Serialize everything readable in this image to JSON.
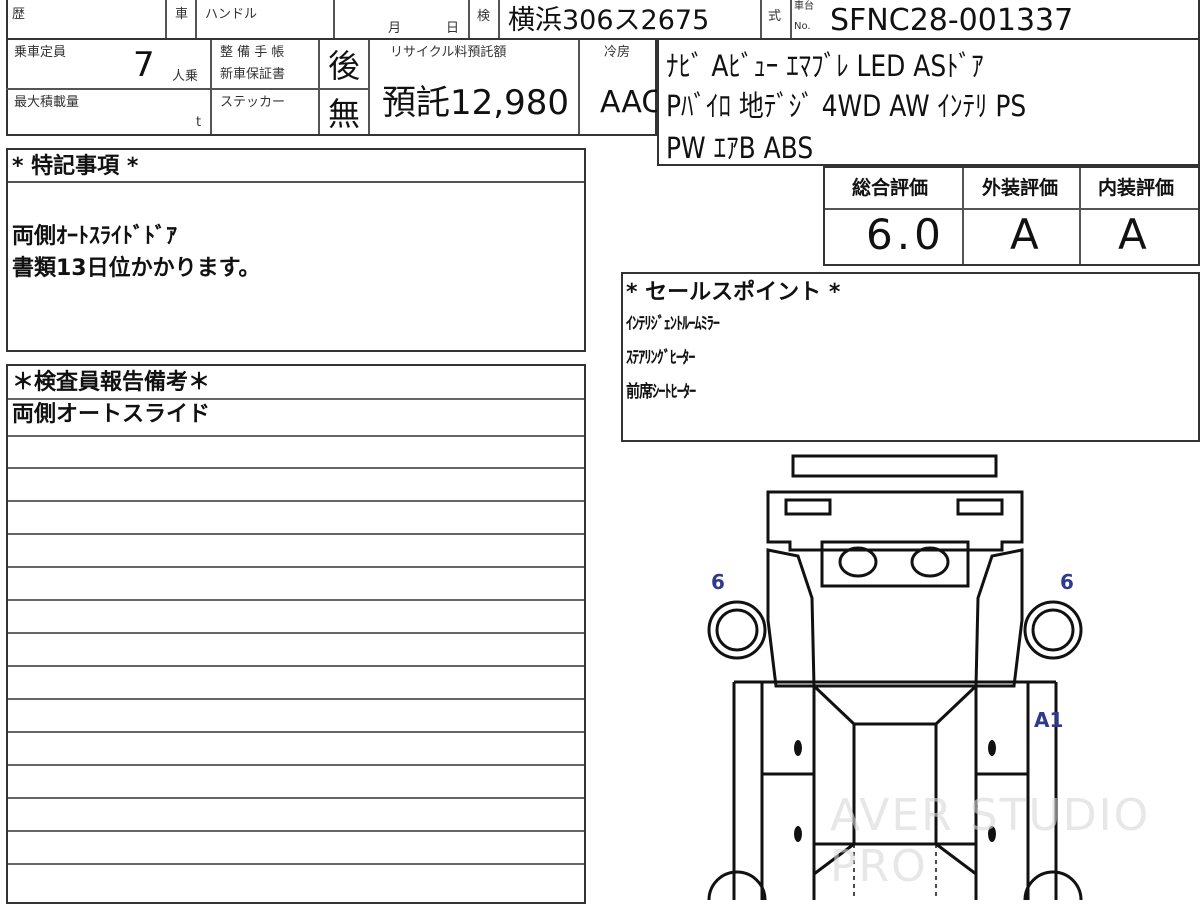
{
  "header": {
    "history_label": "歴",
    "steering_label_1": "車",
    "steering_label_2": "ハンドル",
    "month_label": "月",
    "day_label": "日",
    "inspection_label": "検",
    "plate_number": "横浜306ス2675",
    "model_label": "式",
    "chassis_label_1": "車台",
    "chassis_label_2": "No.",
    "chassis_number": "SFNC28-001337"
  },
  "row2": {
    "capacity_label": "乗車定員",
    "capacity_value": "7",
    "capacity_unit": "人乗",
    "maintenance_label": "整 備 手 帳",
    "warranty_label": "新車保証書",
    "maintenance_value": "後",
    "recycle_label": "リサイクル料預託額",
    "recycle_value": "預託12,980",
    "aircon_label": "冷房",
    "aircon_value": "AAC",
    "max_load_label": "最大積載量",
    "max_load_unit": "t",
    "sticker_label": "ステッカー",
    "sticker_value": "無"
  },
  "equipment": {
    "lines": [
      "ﾅﾋﾞ Aﾋﾞｭｰ ｴﾏﾌﾞﾚ LED ASﾄﾞｱ",
      "Pﾊﾞｲﾛ 地ﾃﾞｼﾞ 4WD AW ｲﾝﾃﾘ PS",
      "PW ｴｱB ABS"
    ]
  },
  "ratings": {
    "overall_label": "総合評価",
    "exterior_label": "外装評価",
    "interior_label": "内装評価",
    "overall_value": "6.0",
    "exterior_value": "A",
    "interior_value": "A"
  },
  "special_notes": {
    "title": "* 特記事項 *",
    "line1": "両側ｵｰﾄｽﾗｲﾄﾞﾄﾞｱ",
    "line2": "書類13日位かかります。"
  },
  "sales_points": {
    "title": "* セールスポイント *",
    "items": [
      "ｲﾝﾃﾘｼﾞｪﾝﾄﾙｰﾑﾐﾗｰ",
      "ｽﾃｱﾘﾝｸﾞﾋｰﾀｰ",
      "前席ｼｰﾄﾋｰﾀｰ"
    ]
  },
  "inspector": {
    "title": "＊検査員報告備考＊",
    "line1": "両側オートスライド"
  },
  "diagram": {
    "marks": {
      "front_left": "6",
      "front_right": "6",
      "right_side": "A1"
    },
    "watermark": "AVER STUDIO PRO",
    "line_color": "#111111",
    "mark_color": "#2e3a8c"
  }
}
